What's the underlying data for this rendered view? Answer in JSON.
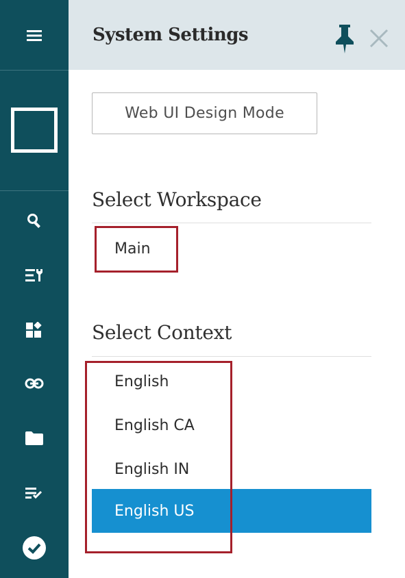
{
  "header": {
    "title": "System Settings"
  },
  "toolbar": {
    "design_mode_label": "Web UI Design Mode"
  },
  "workspace": {
    "section_title": "Select Workspace",
    "items": [
      {
        "label": "Main"
      }
    ]
  },
  "context": {
    "section_title": "Select Context",
    "items": [
      {
        "label": "English",
        "selected": false
      },
      {
        "label": "English CA",
        "selected": false
      },
      {
        "label": "English IN",
        "selected": false
      },
      {
        "label": "English US",
        "selected": true
      }
    ]
  },
  "sidebar": {
    "icons": [
      "menu-icon",
      "window-icon",
      "search-icon",
      "list-settings-icon",
      "widgets-icon",
      "link-icon",
      "folder-icon",
      "checklist-icon",
      "check-circle-icon"
    ]
  },
  "colors": {
    "rail": "#0f4f5c",
    "header": "#dde6ea",
    "selected": "#1690d0",
    "highlight": "#a5202b"
  }
}
